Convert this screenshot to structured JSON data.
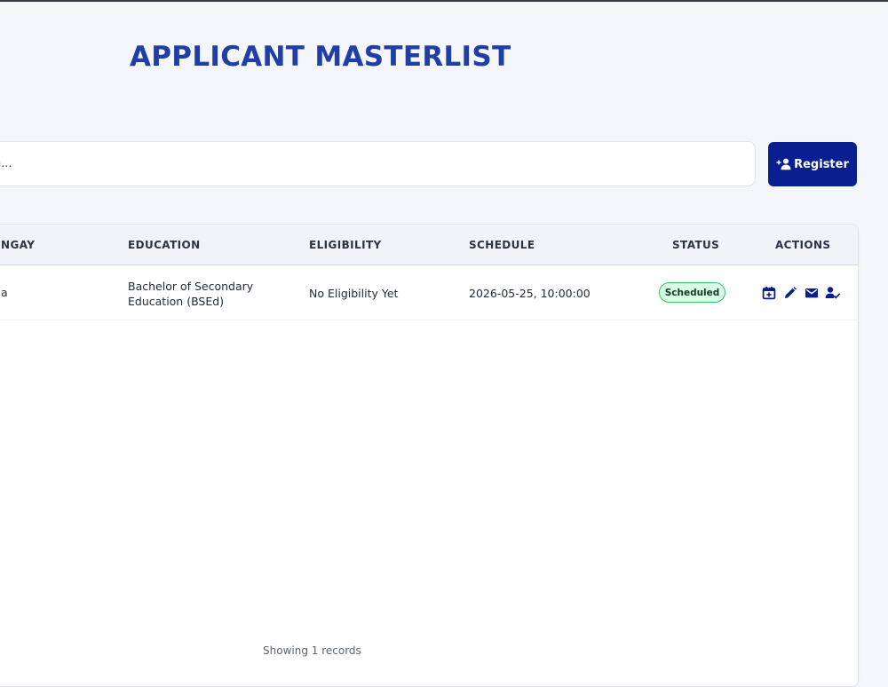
{
  "header": {
    "title": "APPLICANT MASTERLIST"
  },
  "search": {
    "placeholder": "h..."
  },
  "toolbar": {
    "register_label": "Register"
  },
  "table": {
    "columns": [
      "NGAY",
      "EDUCATION",
      "ELIGIBILITY",
      "SCHEDULE",
      "STATUS",
      "ACTIONS"
    ],
    "rows": [
      {
        "barangay": "a",
        "education": "Bachelor of Secondary Education (BSEd)",
        "eligibility": "No Eligibility Yet",
        "schedule": "2026-05-25, 10:00:00",
        "status": "Scheduled"
      }
    ]
  },
  "footer": {
    "records_text": "Showing 1 records"
  },
  "icons": {
    "register": "add-user-icon",
    "schedule": "calendar-add-icon",
    "edit": "pencil-icon",
    "email": "envelope-icon",
    "approve": "user-check-icon"
  },
  "colors": {
    "title": "#1f3fa6",
    "primary": "#0a1f8f",
    "status_bg": "#dcfce7",
    "status_border": "#34c36a"
  }
}
